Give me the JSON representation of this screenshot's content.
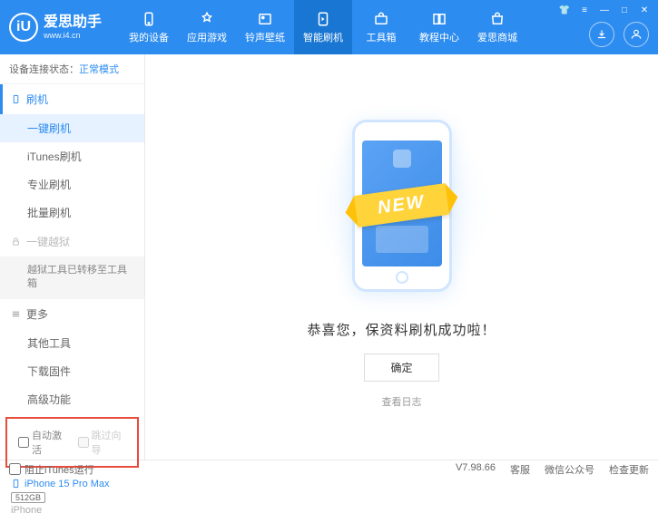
{
  "header": {
    "logo_text": "爱思助手",
    "logo_letter": "iU",
    "logo_url": "www.i4.cn",
    "nav": [
      {
        "label": "我的设备"
      },
      {
        "label": "应用游戏"
      },
      {
        "label": "铃声壁纸"
      },
      {
        "label": "智能刷机"
      },
      {
        "label": "工具箱"
      },
      {
        "label": "教程中心"
      },
      {
        "label": "爱思商城"
      }
    ]
  },
  "sidebar": {
    "status_label": "设备连接状态：",
    "status_value": "正常模式",
    "flash_section": "刷机",
    "flash_items": [
      "一键刷机",
      "iTunes刷机",
      "专业刷机",
      "批量刷机"
    ],
    "jailbreak_section": "一键越狱",
    "jailbreak_note": "越狱工具已转移至工具箱",
    "more_section": "更多",
    "more_items": [
      "其他工具",
      "下载固件",
      "高级功能"
    ],
    "checkbox_auto": "自动激活",
    "checkbox_skip": "跳过向导",
    "device_name": "iPhone 15 Pro Max",
    "device_storage": "512GB",
    "device_type": "iPhone"
  },
  "main": {
    "new_badge": "NEW",
    "success_msg": "恭喜您，保资料刷机成功啦！",
    "confirm": "确定",
    "view_log": "查看日志"
  },
  "footer": {
    "block_itunes": "阻止iTunes运行",
    "version": "V7.98.66",
    "links": [
      "客服",
      "微信公众号",
      "检查更新"
    ]
  }
}
